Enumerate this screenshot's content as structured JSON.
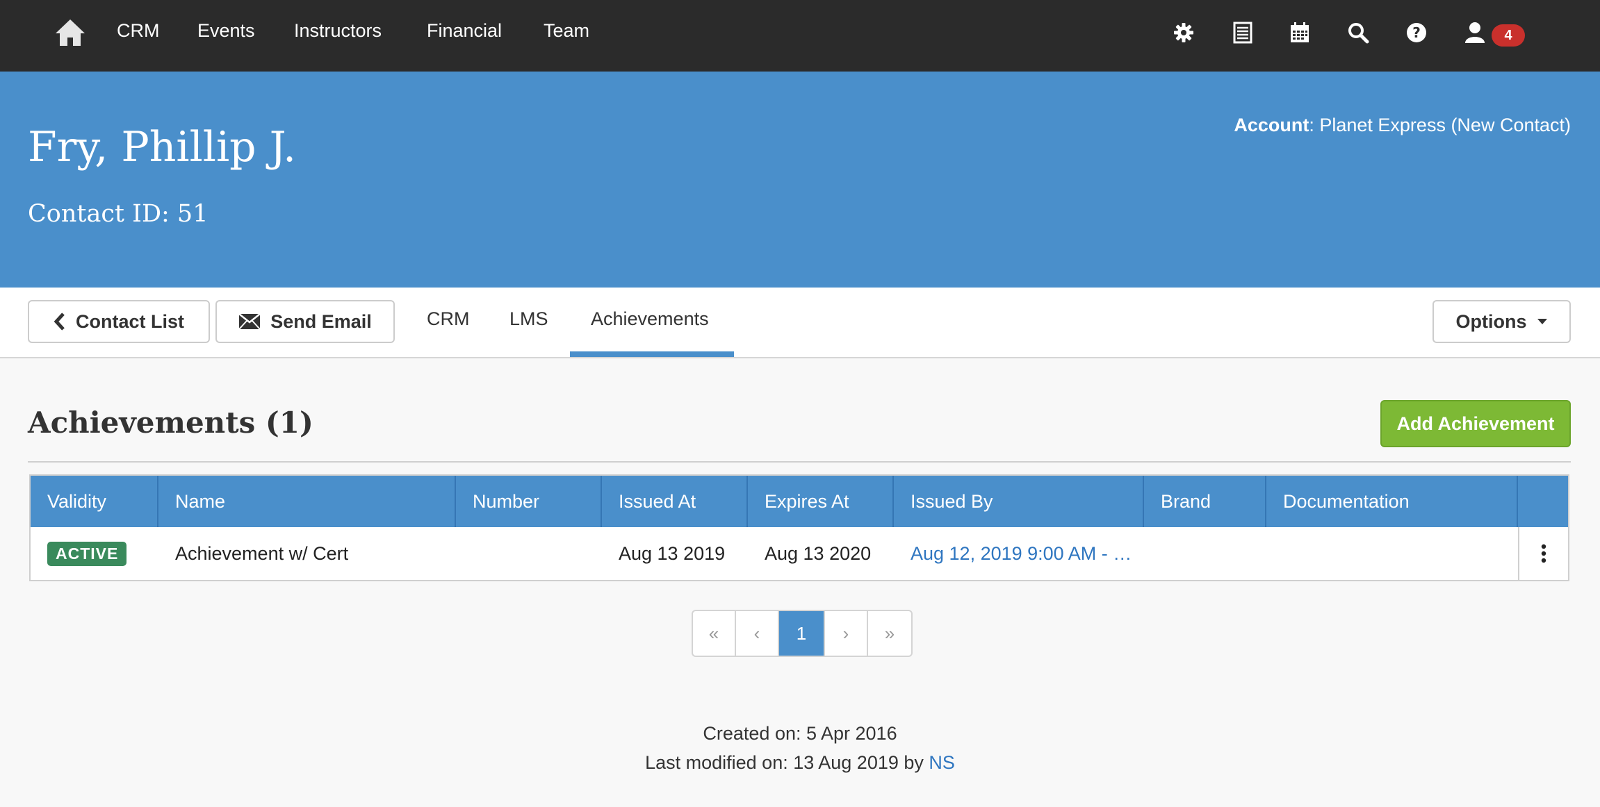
{
  "nav": {
    "home_icon": "home-icon",
    "links": [
      "CRM",
      "Events",
      "Instructors",
      "Financial",
      "Team"
    ],
    "icons": [
      "gear-icon",
      "list-icon",
      "calendar-icon",
      "search-icon",
      "help-icon",
      "user-icon"
    ],
    "notification_count": "4"
  },
  "contact": {
    "name": "Fry, Phillip J.",
    "id_label": "Contact ID: 51",
    "account_label": "Account",
    "account_value": ": Planet Express (New Contact)"
  },
  "toolbar": {
    "contact_list_label": "Contact List",
    "send_email_label": "Send Email",
    "tabs": [
      "CRM",
      "LMS",
      "Achievements"
    ],
    "active_tab": "Achievements",
    "options_label": "Options"
  },
  "section": {
    "title": "Achievements (1)",
    "add_button_label": "Add Achievement"
  },
  "table": {
    "headers": [
      "Validity",
      "Name",
      "Number",
      "Issued At",
      "Expires At",
      "Issued By",
      "Brand",
      "Documentation"
    ],
    "rows": [
      {
        "validity": "ACTIVE",
        "name": "Achievement w/ Cert",
        "number": "",
        "issued_at": "Aug 13 2019",
        "expires_at": "Aug 13 2020",
        "issued_by": "Aug 12, 2019 9:00 AM - …",
        "brand": "",
        "documentation": ""
      }
    ]
  },
  "pagination": {
    "first": "«",
    "prev": "‹",
    "current": "1",
    "next": "›",
    "last": "»"
  },
  "footer": {
    "created": "Created on: 5 Apr 2016",
    "modified_prefix": "Last modified on: 13 Aug 2019 by ",
    "modified_by": "NS"
  },
  "colors": {
    "navbar": "#2b2b2b",
    "primary": "#4a8fcb",
    "success": "#7db935",
    "active_badge": "#3a8a5c",
    "notification": "#c9302c"
  }
}
